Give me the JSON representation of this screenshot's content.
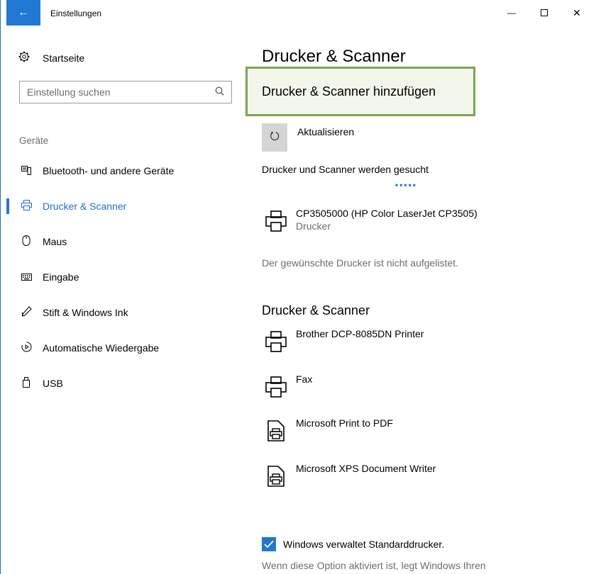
{
  "window": {
    "title": "Einstellungen",
    "back_icon": "←",
    "minimize_icon": "—",
    "close_icon": "✕"
  },
  "sidebar": {
    "home_label": "Startseite",
    "search_placeholder": "Einstellung suchen",
    "section_heading": "Geräte",
    "items": [
      {
        "label": "Bluetooth- und andere Geräte",
        "icon": "bluetooth-devices-icon",
        "glyph": "▦",
        "selected": false
      },
      {
        "label": "Drucker & Scanner",
        "icon": "printer-icon",
        "glyph": "⎙",
        "selected": true
      },
      {
        "label": "Maus",
        "icon": "mouse-icon",
        "glyph": "⌂",
        "selected": false
      },
      {
        "label": "Eingabe",
        "icon": "keyboard-icon",
        "glyph": "⌨",
        "selected": false
      },
      {
        "label": "Stift & Windows Ink",
        "icon": "pen-icon",
        "glyph": "✎",
        "selected": false
      },
      {
        "label": "Automatische Wiedergabe",
        "icon": "autoplay-icon",
        "glyph": "⟳",
        "selected": false
      },
      {
        "label": "USB",
        "icon": "usb-icon",
        "glyph": "▯",
        "selected": false
      }
    ]
  },
  "main": {
    "title": "Drucker & Scanner",
    "add_button": "Drucker & Scanner hinzufügen",
    "refresh_label": "Aktualisieren",
    "searching_text": "Drucker und Scanner werden gesucht",
    "searching_dots": "•••••",
    "found_device": {
      "name": "CP3505000 (HP Color LaserJet CP3505)",
      "type": "Drucker"
    },
    "not_listed_link": "Der gewünschte Drucker ist nicht aufgelistet.",
    "section_heading": "Drucker & Scanner",
    "devices": [
      {
        "name": "Brother DCP-8085DN Printer",
        "icon": "printer-icon"
      },
      {
        "name": "Fax",
        "icon": "printer-icon"
      },
      {
        "name": "Microsoft Print to PDF",
        "icon": "document-printer-icon"
      },
      {
        "name": "Microsoft XPS Document Writer",
        "icon": "document-printer-icon"
      }
    ],
    "default_printer_checkbox": {
      "label": "Windows verwaltet Standarddrucker.",
      "checked": true
    },
    "description": "Wenn diese Option aktiviert ist, legt Windows Ihren"
  },
  "colors": {
    "accent": "#1f78d1",
    "highlight_border": "#77a84b",
    "highlight_fill": "#f2f5ea",
    "secondary_text": "#6d6d6d"
  }
}
